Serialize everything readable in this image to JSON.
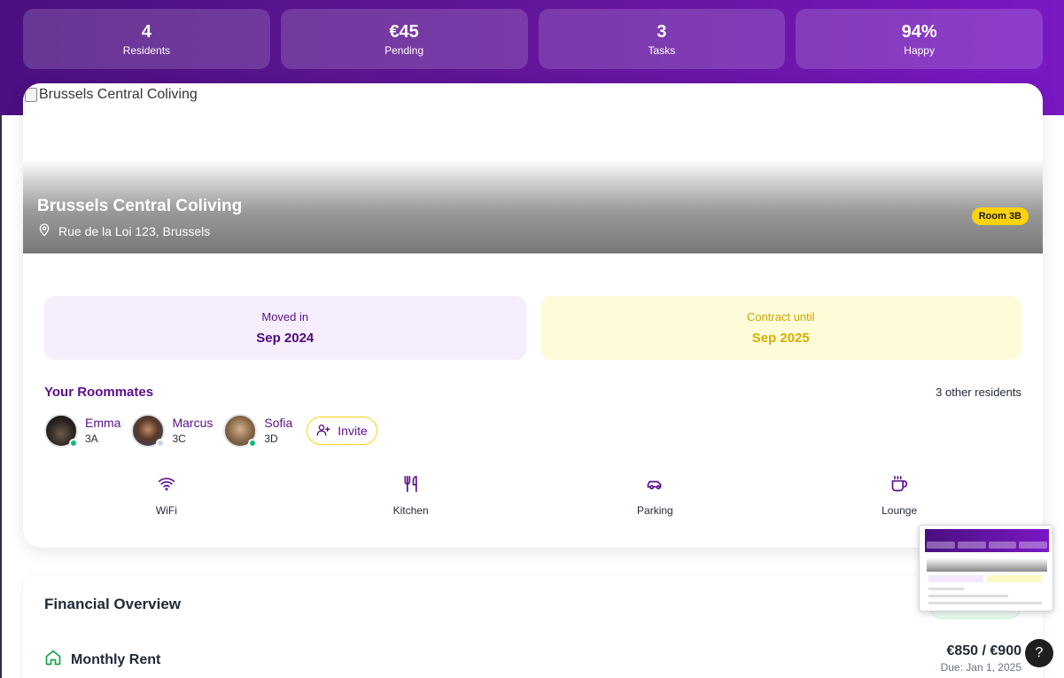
{
  "stats": [
    {
      "value": "4",
      "label": "Residents"
    },
    {
      "value": "€45",
      "label": "Pending"
    },
    {
      "value": "3",
      "label": "Tasks"
    },
    {
      "value": "94%",
      "label": "Happy"
    }
  ],
  "property": {
    "image_alt": "Brussels Central Coliving",
    "name": "Brussels Central Coliving",
    "address": "Rue de la Loi 123, Brussels",
    "room_badge": "Room 3B",
    "icons": {
      "address": "map-pin-icon"
    }
  },
  "dates": {
    "moved_in": {
      "label": "Moved in",
      "value": "Sep 2024"
    },
    "contract": {
      "label": "Contract until",
      "value": "Sep 2025"
    }
  },
  "roommates": {
    "title": "Your Roommates",
    "count_text": "3 other residents",
    "items": [
      {
        "name": "Emma",
        "room": "3A",
        "status": "online"
      },
      {
        "name": "Marcus",
        "room": "3C",
        "status": "offline"
      },
      {
        "name": "Sofia",
        "room": "3D",
        "status": "online"
      }
    ],
    "invite_label": "Invite",
    "invite_icon": "user-plus-icon"
  },
  "amenities": [
    {
      "label": "WiFi",
      "icon": "wifi-icon"
    },
    {
      "label": "Kitchen",
      "icon": "utensils-icon"
    },
    {
      "label": "Parking",
      "icon": "car-icon"
    },
    {
      "label": "Lounge",
      "icon": "coffee-icon"
    }
  ],
  "financial": {
    "title": "Financial Overview",
    "rent": {
      "label": "Monthly Rent",
      "amount": "€850 / €900",
      "due": "Due: Jan 1, 2025",
      "icon": "home-icon"
    }
  },
  "help_label": "?",
  "colors": {
    "brand_purple": "#5b0f8a",
    "accent_yellow": "#fcd20f",
    "online_green": "#10b981",
    "header_gradient_start": "#4b0f80",
    "header_gradient_end": "#7a18c4"
  }
}
